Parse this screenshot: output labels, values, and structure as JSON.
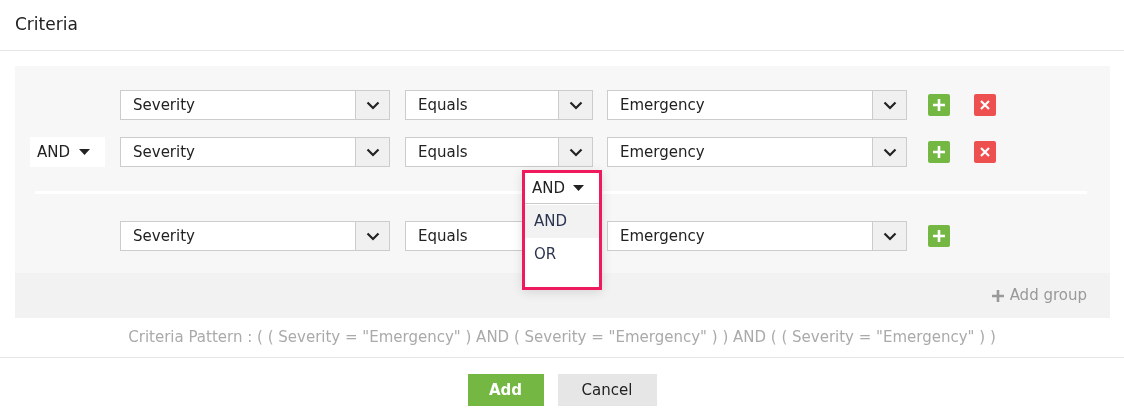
{
  "dialog": {
    "title": "Criteria"
  },
  "groups": [
    {
      "conditions": [
        {
          "field": "Severity",
          "operator": "Equals",
          "value": "Emergency",
          "removable": true
        },
        {
          "join": "AND",
          "field": "Severity",
          "operator": "Equals",
          "value": "Emergency",
          "removable": true
        }
      ]
    },
    {
      "conditions": [
        {
          "field": "Severity",
          "operator": "Equals",
          "value": "Emergency",
          "removable": false
        }
      ]
    }
  ],
  "group_join": {
    "value": "AND",
    "expanded": true,
    "options": [
      {
        "label": "AND",
        "selected": true
      },
      {
        "label": "OR",
        "selected": false
      }
    ]
  },
  "add_group": "Add group",
  "pattern": "Criteria Pattern : ( ( Severity = \"Emergency\" ) AND ( Severity = \"Emergency\" ) ) AND ( ( Severity = \"Emergency\" ) )",
  "buttons": [
    {
      "label": "Add",
      "kind": "primary"
    },
    {
      "label": "Cancel",
      "kind": "secondary"
    }
  ]
}
